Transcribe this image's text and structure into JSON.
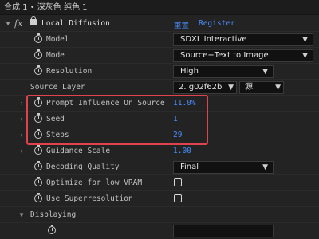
{
  "title": "合成 1 • 深灰色 纯色 1",
  "effect": {
    "fx_label": "fx",
    "name": "Local Diffusion",
    "reset_label": "重置",
    "register_label": "Register"
  },
  "params": {
    "model": {
      "label": "Model",
      "value": "SDXL Interactive"
    },
    "mode": {
      "label": "Mode",
      "value": "Source+Text to Image"
    },
    "resolution": {
      "label": "Resolution",
      "value": "High"
    },
    "source_layer": {
      "label": "Source Layer",
      "layer_value": "2. g02f62b",
      "source_value": "源"
    },
    "prompt_influence": {
      "label": "Prompt Influence On Source",
      "value": "11.0%"
    },
    "seed": {
      "label": "Seed",
      "value": "1"
    },
    "steps": {
      "label": "Steps",
      "value": "29"
    },
    "guidance": {
      "label": "Guidance Scale",
      "value": "1.00"
    },
    "decoding": {
      "label": "Decoding Quality",
      "value": "Final"
    },
    "vram": {
      "label": "Optimize for low VRAM",
      "checked": false
    },
    "superres": {
      "label": "Use Superresolution",
      "checked": false
    }
  },
  "displaying": {
    "label": "Displaying"
  },
  "colors": {
    "accent": "#4a8dff",
    "highlight": "#e0434e"
  }
}
